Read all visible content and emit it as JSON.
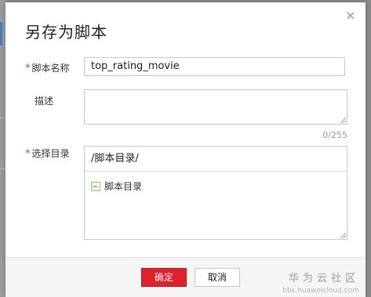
{
  "dialog": {
    "title": "另存为脚本",
    "close_symbol": "×"
  },
  "form": {
    "name_label": "脚本名称",
    "name_value": "top_rating_movie",
    "desc_label": "描述",
    "desc_counter": "0/255",
    "dir_label": "选择目录",
    "dir_path": "/脚本目录/",
    "dir_tree": [
      {
        "label": "脚本目录",
        "icon": "folder-icon"
      }
    ],
    "required_mark": "*"
  },
  "footer": {
    "ok_label": "确定",
    "cancel_label": "取消"
  },
  "watermark": {
    "title": "华为云社区",
    "url": "bbs.huaweicloud.com"
  },
  "colors": {
    "accent": "#e0202a",
    "required": "#ee3333"
  }
}
